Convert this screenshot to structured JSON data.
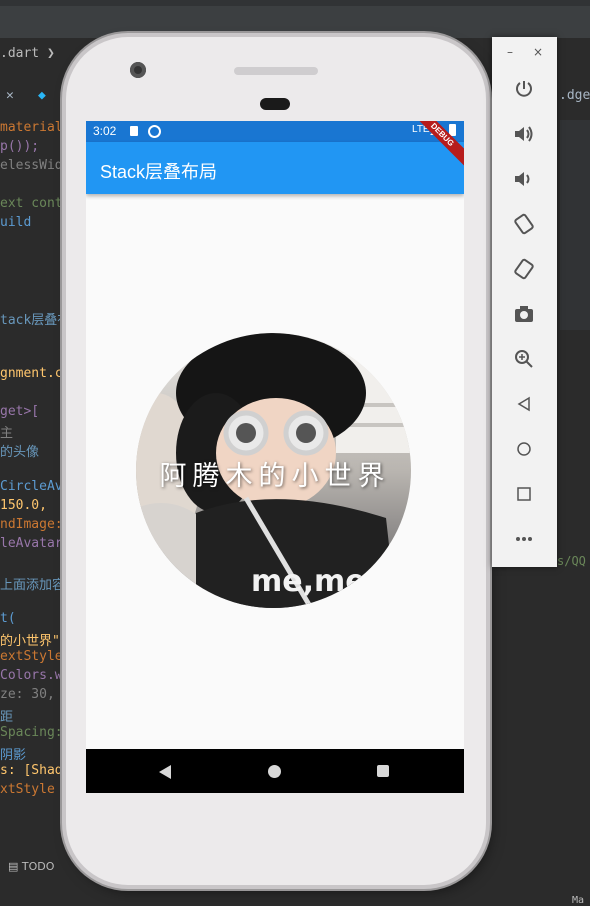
{
  "ide": {
    "breadcrumb_file": ".dart",
    "tab_partial": "b",
    "right_tab_partial": ".dget",
    "right_path_partial": "s/QQ",
    "code_lines": [
      "material.",
      "p());",
      "elessWidg",
      "",
      "ext conte",
      "uild",
      "",
      "",
      "",
      "",
      "tack层叠布",
      "",
      "",
      "gnment.ce",
      "",
      "get>[",
      "主",
      "的头像",
      "",
      "CircleAv",
      "150.0,",
      "ndImage:",
      "leAvatar",
      "",
      "上面添加容",
      "",
      "t(",
      "的小世界\"",
      "extStyle(",
      "Colors.w",
      "ze: 30,",
      "距",
      "Spacing:",
      "阴影",
      "s: [Shado",
      "xtStyle"
    ],
    "todo_label": "TODO",
    "corner_label": "Ma"
  },
  "device": {
    "status_time": "3:02",
    "status_network": "LTE",
    "app_title": "Stack层叠布局",
    "debug_banner": "DEBUG",
    "avatar_overlay_text": "阿腾木的小世界",
    "shirt_text": "me,me"
  },
  "emulator": {
    "minimize": "–",
    "close": "×",
    "tools": [
      "power-icon",
      "volume-up-icon",
      "volume-down-icon",
      "rotate-left-icon",
      "rotate-right-icon",
      "camera-icon",
      "zoom-icon",
      "back-icon",
      "home-icon",
      "overview-icon",
      "more-icon"
    ]
  },
  "colors": {
    "status_bar": "#1976d2",
    "app_bar": "#2196f3",
    "ide_bg": "#2b2b2b"
  }
}
